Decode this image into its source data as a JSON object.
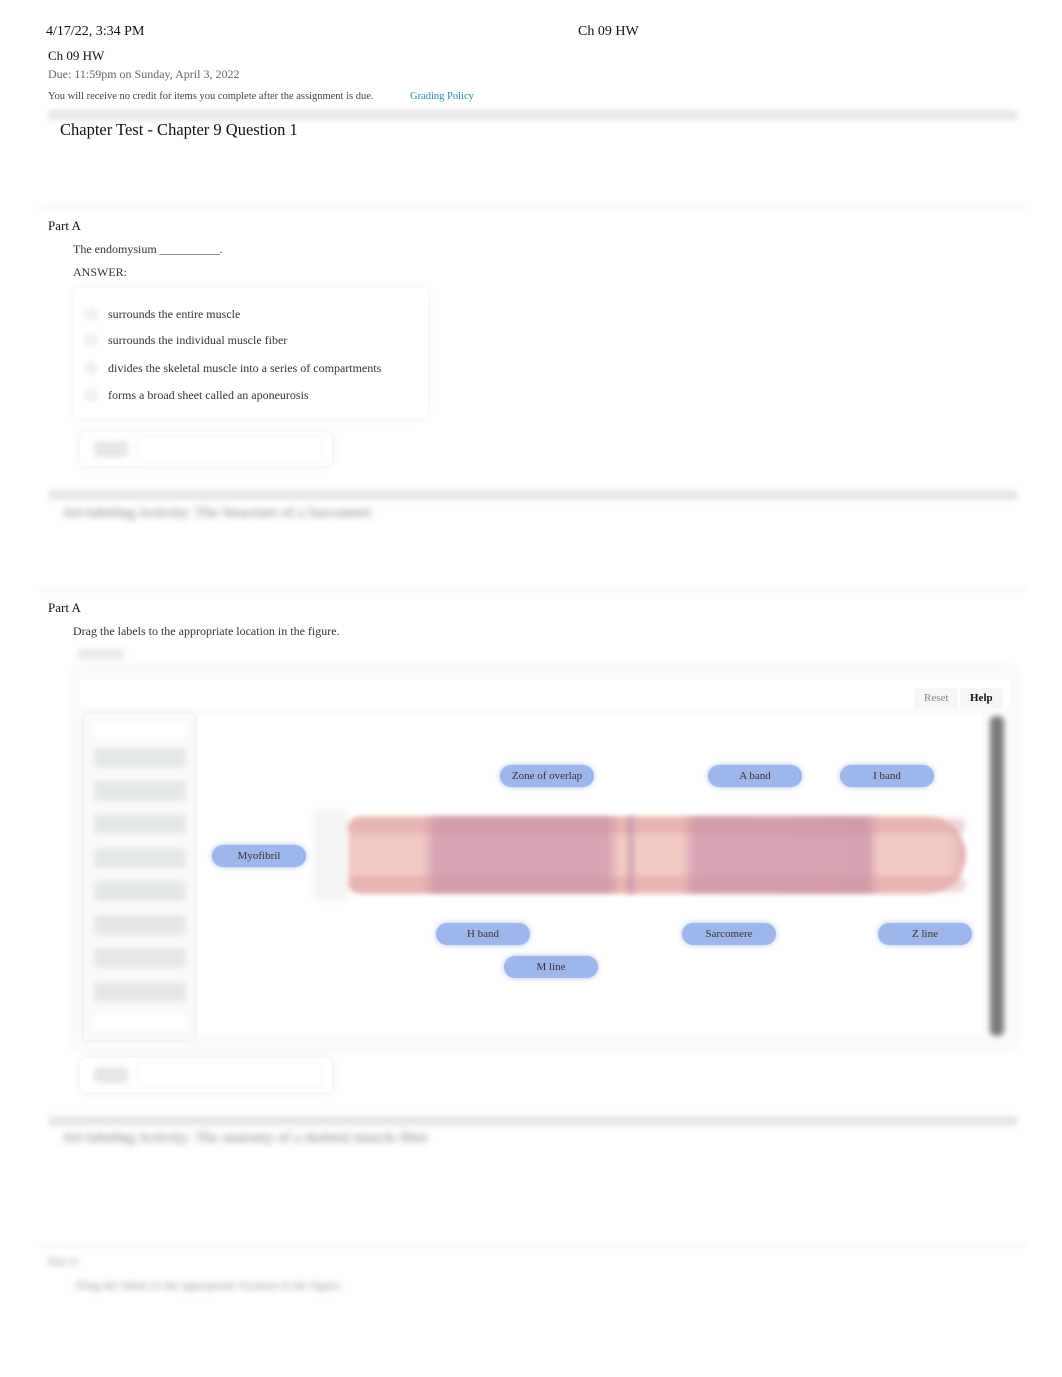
{
  "print_header": {
    "datetime": "4/17/22, 3:34 PM",
    "doc_title": "Ch 09 HW"
  },
  "assignment": {
    "title": "Ch 09 HW",
    "due": "Due: 11:59pm on Sunday, April 3, 2022",
    "notice": "You will receive no credit for items you complete after the assignment is due.",
    "grading_policy_link": "Grading Policy"
  },
  "question1": {
    "title": "Chapter Test - Chapter 9 Question 1",
    "part_label": "Part A",
    "prompt": "The endomysium __________.",
    "answer_label": "ANSWER:",
    "choices": [
      "surrounds the entire muscle",
      "surrounds the individual muscle fiber",
      "divides the skeletal muscle into a series of compartments",
      "forms a broad sheet called an aponeurosis"
    ]
  },
  "question2": {
    "title_blurred": "Art-labeling Activity: The Structure of a Sarcomere",
    "part_label": "Part A",
    "prompt": "Drag the labels to the appropriate location in the figure.",
    "toolbar": {
      "reset": "Reset",
      "help": "Help"
    },
    "labels": {
      "myofibril": "Myofibril",
      "zone_of_overlap": "Zone of overlap",
      "a_band": "A band",
      "i_band": "I band",
      "h_band": "H band",
      "m_line": "M line",
      "sarcomere": "Sarcomere",
      "z_line": "Z line"
    }
  },
  "question3": {
    "title_blurred": "Art-labeling Activity: The anatomy of a skeletal muscle fiber",
    "part_label_blurred": "Part A",
    "prompt_blurred": "Drag the labels to the appropriate location in the figure."
  }
}
